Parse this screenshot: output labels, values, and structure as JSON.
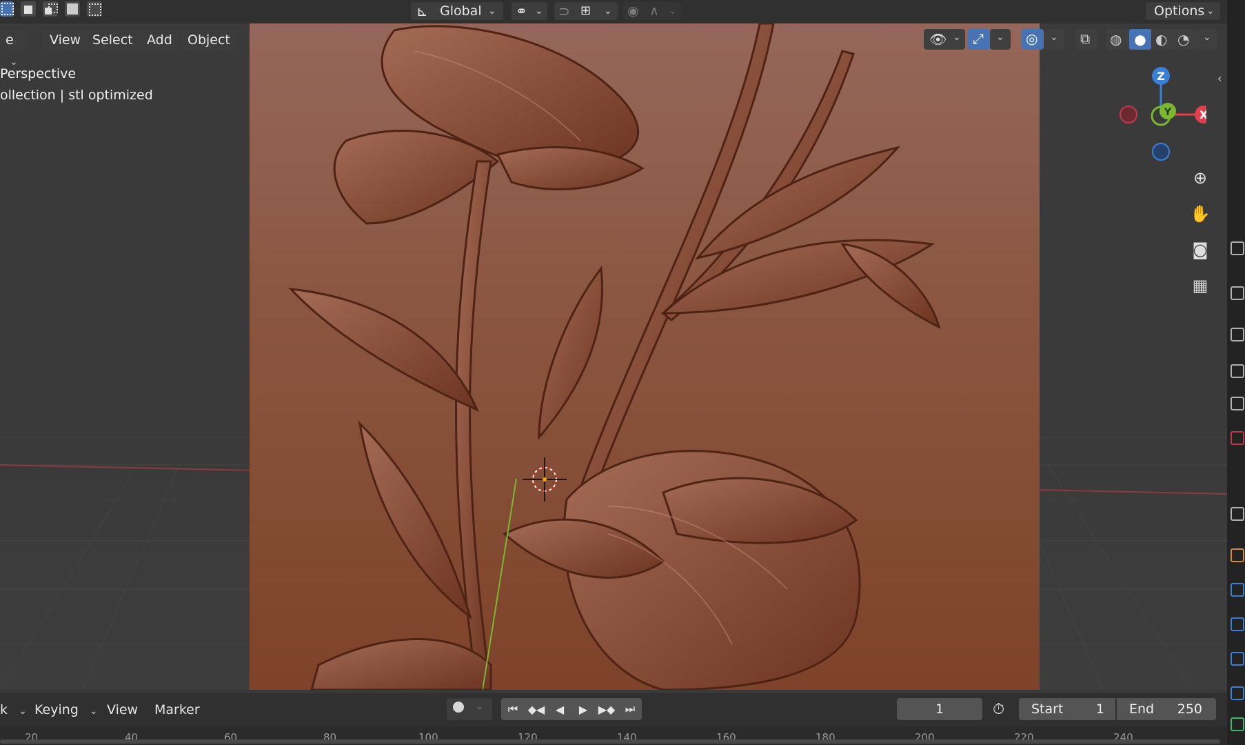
{
  "header": {
    "transform_orientation": "Global",
    "options_label": "Options"
  },
  "viewport": {
    "mode_fragment": "e",
    "menu": {
      "view": "View",
      "select": "Select",
      "add": "Add",
      "object": "Object"
    },
    "overlay": {
      "view_name": "Perspective",
      "collection_info": "ollection | stl optimized"
    },
    "gizmo": {
      "z": "Z",
      "y": "Y",
      "x": "X"
    },
    "nav_icons": [
      "zoom-icon",
      "hand-icon",
      "camera-icon",
      "grid-icon"
    ]
  },
  "timeline": {
    "mode_fragment": "k",
    "keying": "Keying",
    "view": "View",
    "marker": "Marker",
    "current_frame": "1",
    "start_label": "Start",
    "start_value": "1",
    "end_label": "End",
    "end_value": "250",
    "ruler_ticks": [
      "20",
      "40",
      "60",
      "80",
      "100",
      "120",
      "140",
      "160",
      "180",
      "200",
      "220",
      "240"
    ]
  },
  "colors": {
    "accent": "#4772b3",
    "axis_x": "#e0404e",
    "axis_y": "#7cb82f",
    "axis_z": "#3a7fd6",
    "relief": "#8a553f"
  }
}
